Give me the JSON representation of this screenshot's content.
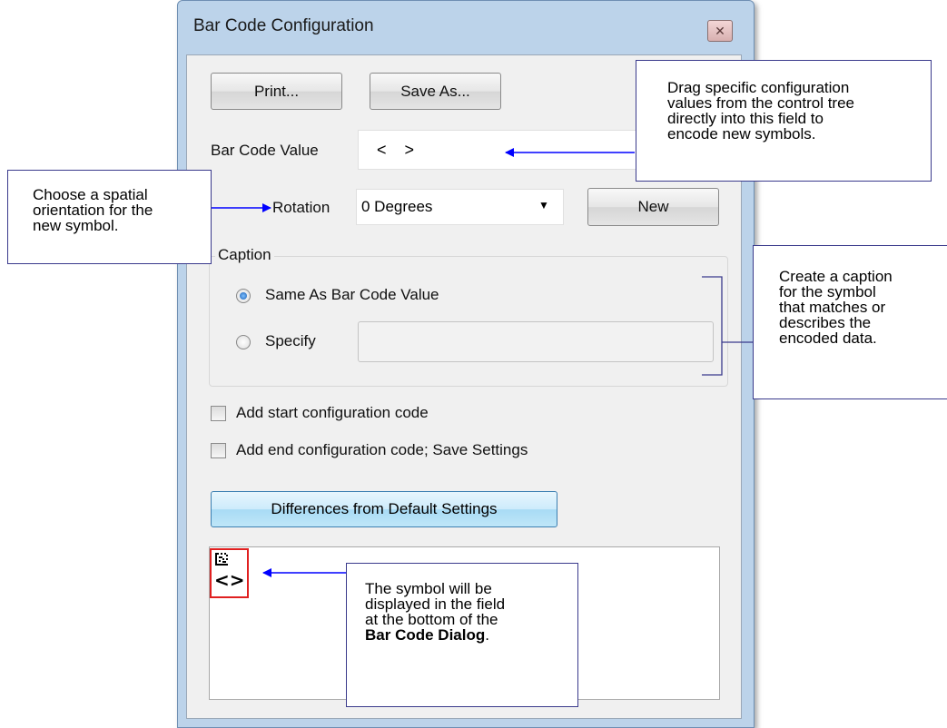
{
  "window": {
    "title": "Bar Code Configuration",
    "close_glyph": "✕"
  },
  "toolbar": {
    "print_label": "Print...",
    "save_as_label": "Save As..."
  },
  "barcode_value": {
    "label": "Bar Code Value",
    "value": "<    >"
  },
  "rotation": {
    "label": "Rotation",
    "selected": "0 Degrees",
    "new_label": "New"
  },
  "caption": {
    "legend": "Caption",
    "options": [
      {
        "label": "Same As Bar Code Value",
        "checked": true
      },
      {
        "label": "Specify",
        "checked": false
      }
    ],
    "specify_value": ""
  },
  "checkboxes": [
    {
      "label": "Add start configuration code",
      "checked": false
    },
    {
      "label": "Add end configuration code; Save Settings",
      "checked": false
    }
  ],
  "differences_label": "Differences from Default Settings",
  "preview": {
    "symbol_text": "<>"
  },
  "callouts": {
    "drag": [
      "Drag specific configuration",
      "values from the control tree",
      "directly into this field to",
      "encode new symbols."
    ],
    "rotation": [
      "Choose a spatial",
      "orientation for the",
      "new symbol."
    ],
    "caption": [
      "Create a caption",
      "for the symbol",
      "that matches or",
      "describes the",
      "encoded data."
    ],
    "symbol": {
      "lines": [
        "The symbol will be",
        "displayed in the field",
        "at the bottom of the"
      ],
      "bold": "Bar Code Dialog",
      "suffix": "."
    }
  },
  "colors": {
    "dialog_frame": "#bcd3ea",
    "arrow": "#0000ff",
    "callout_border": "#3a3a8c",
    "symbol_border": "#e02020",
    "accent_button": "#a8dbf5"
  }
}
